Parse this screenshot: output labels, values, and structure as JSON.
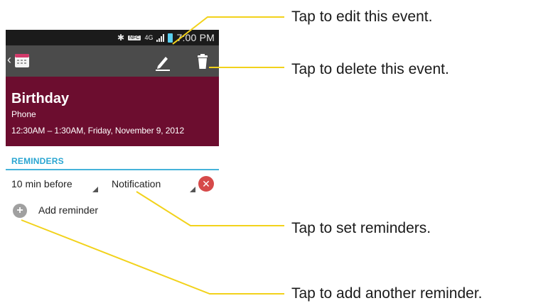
{
  "status_bar": {
    "time": "7:00 PM",
    "nfc_label": "NFC",
    "network_label": "4G",
    "icons": [
      "bluetooth-icon",
      "nfc-icon",
      "4g-icon",
      "signal-icon",
      "battery-icon"
    ]
  },
  "action_bar": {
    "icons": [
      "back-chevron-icon",
      "calendar-icon",
      "pencil-icon",
      "trash-icon"
    ]
  },
  "event": {
    "title": "Birthday",
    "calendar": "Phone",
    "time_range": "12:30AM – 1:30AM, Friday, November 9, 2012"
  },
  "reminders": {
    "section_title": "REMINDERS",
    "minutes_value": "10 min before",
    "method_value": "Notification",
    "add_label": "Add reminder"
  },
  "callouts": {
    "edit": "Tap to edit this event.",
    "delete": "Tap to delete this event.",
    "set_reminders": "Tap to set reminders.",
    "add_reminder": "Tap to add another reminder."
  },
  "colors": {
    "header_bg": "#6c0d2f",
    "action_bar_bg": "#4b4b4b",
    "status_bar_bg": "#1b1b1b",
    "accent_blue": "#2aa6d2",
    "remove_red": "#d64a4a",
    "leader_yellow": "#f2d21b"
  }
}
